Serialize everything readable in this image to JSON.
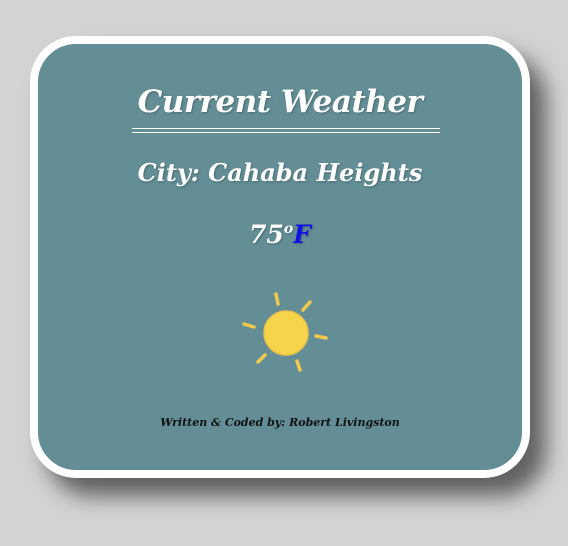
{
  "header": {
    "title": "Current Weather"
  },
  "weather": {
    "city_label": "City: Cahaba Heights",
    "temperature": "75",
    "degree_symbol": "o",
    "unit": "F",
    "condition_icon": "sun-icon"
  },
  "footer": {
    "credit": "Written & Coded by: Robert Livingston"
  },
  "colors": {
    "page_background": "#d3d3d3",
    "card_background": "#638e96",
    "card_border": "#ffffff",
    "unit_accent": "#1010e6",
    "sun_fill": "#f7d54a"
  }
}
